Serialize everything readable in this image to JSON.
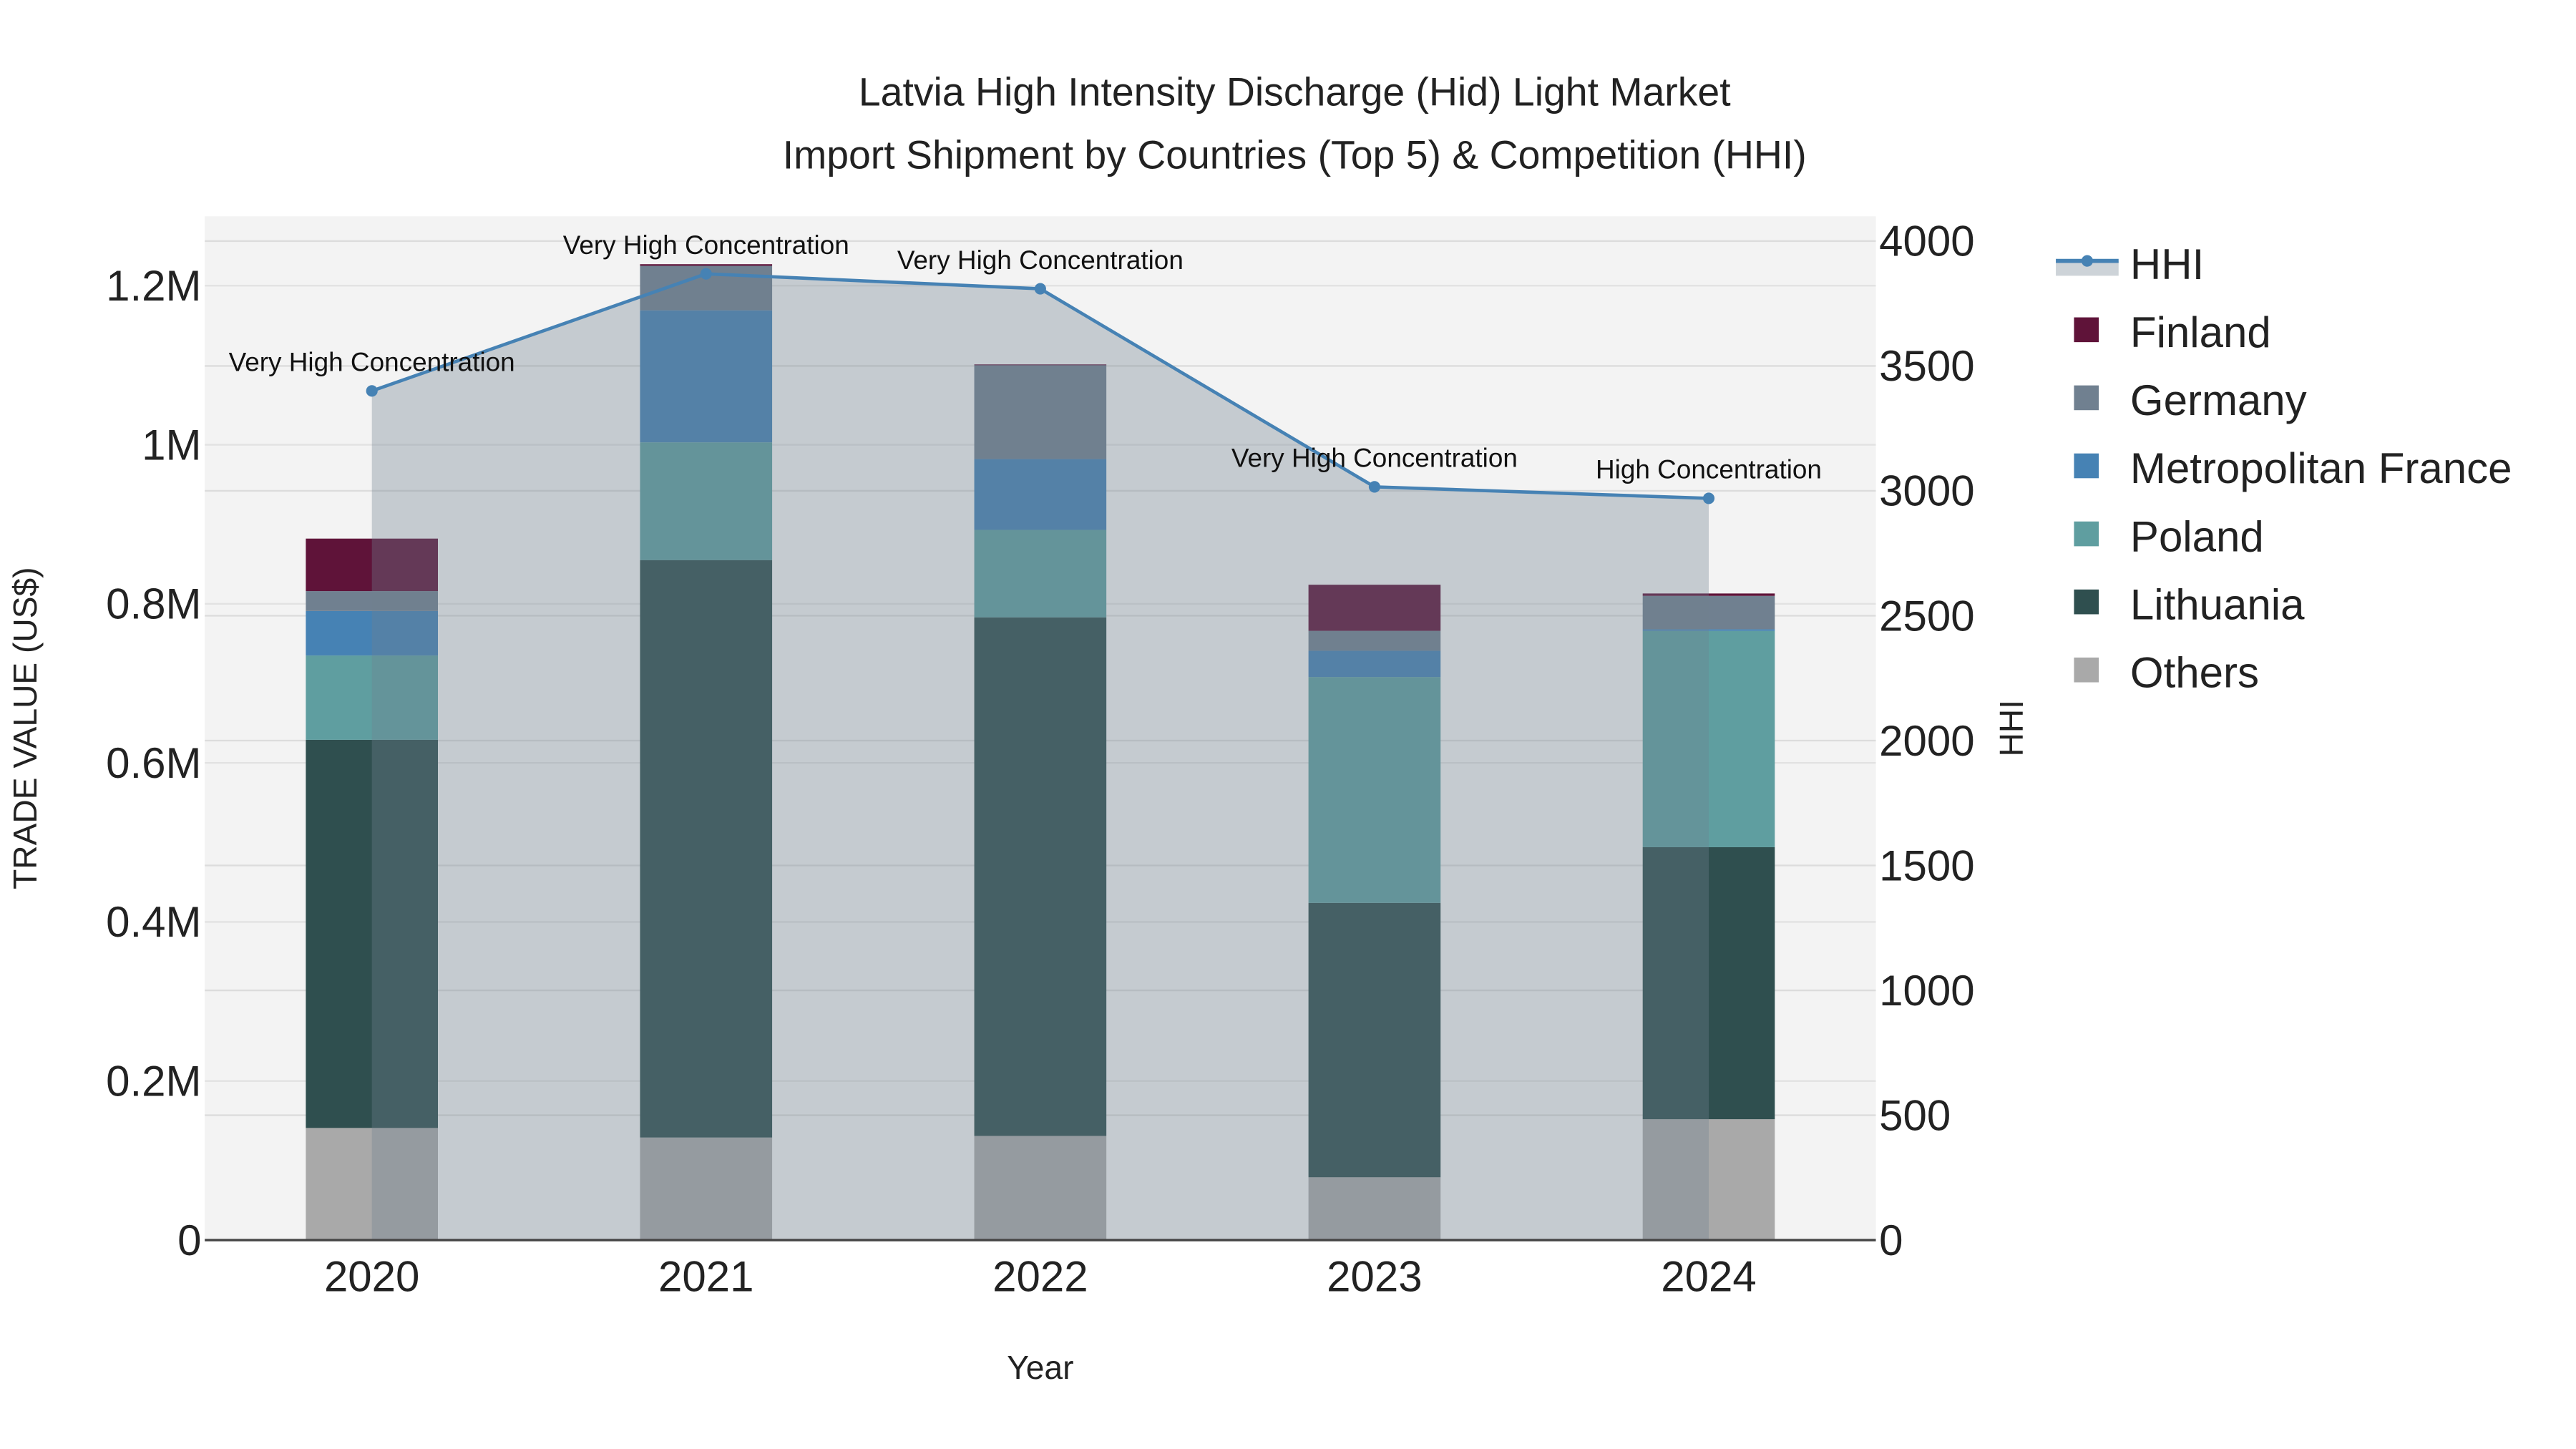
{
  "chart_data": {
    "type": "bar",
    "title_line1": "Latvia High Intensity Discharge (Hid) Light Market",
    "title_line2": "Import Shipment by Countries (Top 5) & Competition (HHI)",
    "xlabel": "Year",
    "ylabel": "TRADE VALUE (US$)",
    "y2label": "HHI",
    "categories": [
      "2020",
      "2021",
      "2022",
      "2023",
      "2024"
    ],
    "ylim": [
      0,
      1280000
    ],
    "y2lim": [
      0,
      4100
    ],
    "yticks": [
      {
        "v": 0,
        "label": "0"
      },
      {
        "v": 200000,
        "label": "0.2M"
      },
      {
        "v": 400000,
        "label": "0.4M"
      },
      {
        "v": 600000,
        "label": "0.6M"
      },
      {
        "v": 800000,
        "label": "0.8M"
      },
      {
        "v": 1000000,
        "label": "1M"
      },
      {
        "v": 1200000,
        "label": "1.2M"
      }
    ],
    "y2ticks": [
      {
        "v": 0,
        "label": "0"
      },
      {
        "v": 500,
        "label": "500"
      },
      {
        "v": 1000,
        "label": "1000"
      },
      {
        "v": 1500,
        "label": "1500"
      },
      {
        "v": 2000,
        "label": "2000"
      },
      {
        "v": 2500,
        "label": "2500"
      },
      {
        "v": 3000,
        "label": "3000"
      },
      {
        "v": 3500,
        "label": "3500"
      },
      {
        "v": 4000,
        "label": "4000"
      }
    ],
    "series": [
      {
        "name": "Others",
        "color": "#a9a9a9",
        "values": [
          141000,
          129000,
          131000,
          79000,
          152000
        ]
      },
      {
        "name": "Lithuania",
        "color": "#2f4f4f",
        "values": [
          488000,
          726000,
          652000,
          345000,
          342000
        ]
      },
      {
        "name": "Poland",
        "color": "#5f9ea0",
        "values": [
          106000,
          148000,
          110000,
          284000,
          272000
        ]
      },
      {
        "name": "Metropolitan France",
        "color": "#4682b4",
        "values": [
          56000,
          166000,
          89000,
          33000,
          2000
        ]
      },
      {
        "name": "Germany",
        "color": "#708090",
        "values": [
          25000,
          56000,
          118000,
          25000,
          42000
        ]
      },
      {
        "name": "Finland",
        "color": "#5f1339",
        "values": [
          66000,
          2000,
          1000,
          58000,
          3000
        ]
      }
    ],
    "hhi": {
      "name": "HHI",
      "color": "#4682b4",
      "values": [
        3400,
        3869,
        3809,
        3016,
        2970
      ],
      "annotations": [
        "Very High Concentration",
        "Very High Concentration",
        "Very High Concentration",
        "Very High Concentration",
        "High Concentration"
      ]
    },
    "legend": {
      "placement": "right",
      "entries": [
        "HHI",
        "Finland",
        "Germany",
        "Metropolitan France",
        "Poland",
        "Lithuania",
        "Others"
      ]
    },
    "grid": true
  }
}
